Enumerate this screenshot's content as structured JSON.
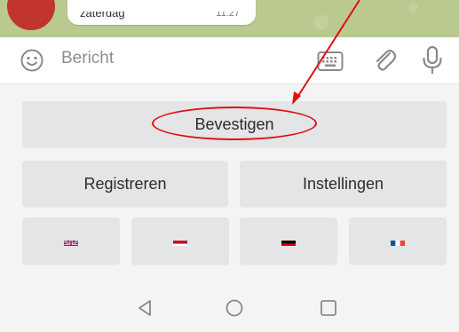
{
  "chat": {
    "message_text": "zaterdag",
    "message_time": "11:27"
  },
  "input": {
    "placeholder": "Bericht",
    "icons": [
      "emoji-icon",
      "keyboard-icon",
      "paperclip-icon",
      "microphone-icon"
    ]
  },
  "keyboard": {
    "confirm_label": "Bevestigen",
    "register_label": "Registreren",
    "settings_label": "Instellingen",
    "languages": [
      {
        "flag": "uk-flag-icon"
      },
      {
        "flag": "netherlands-flag-icon"
      },
      {
        "flag": "germany-flag-icon"
      },
      {
        "flag": "france-flag-icon"
      }
    ]
  },
  "navigation": {
    "buttons": [
      "back-icon",
      "home-icon",
      "recents-icon"
    ]
  },
  "colors": {
    "annotation": "#e01010",
    "button_bg": "#e3e5e6",
    "avatar": "#c1352c"
  }
}
